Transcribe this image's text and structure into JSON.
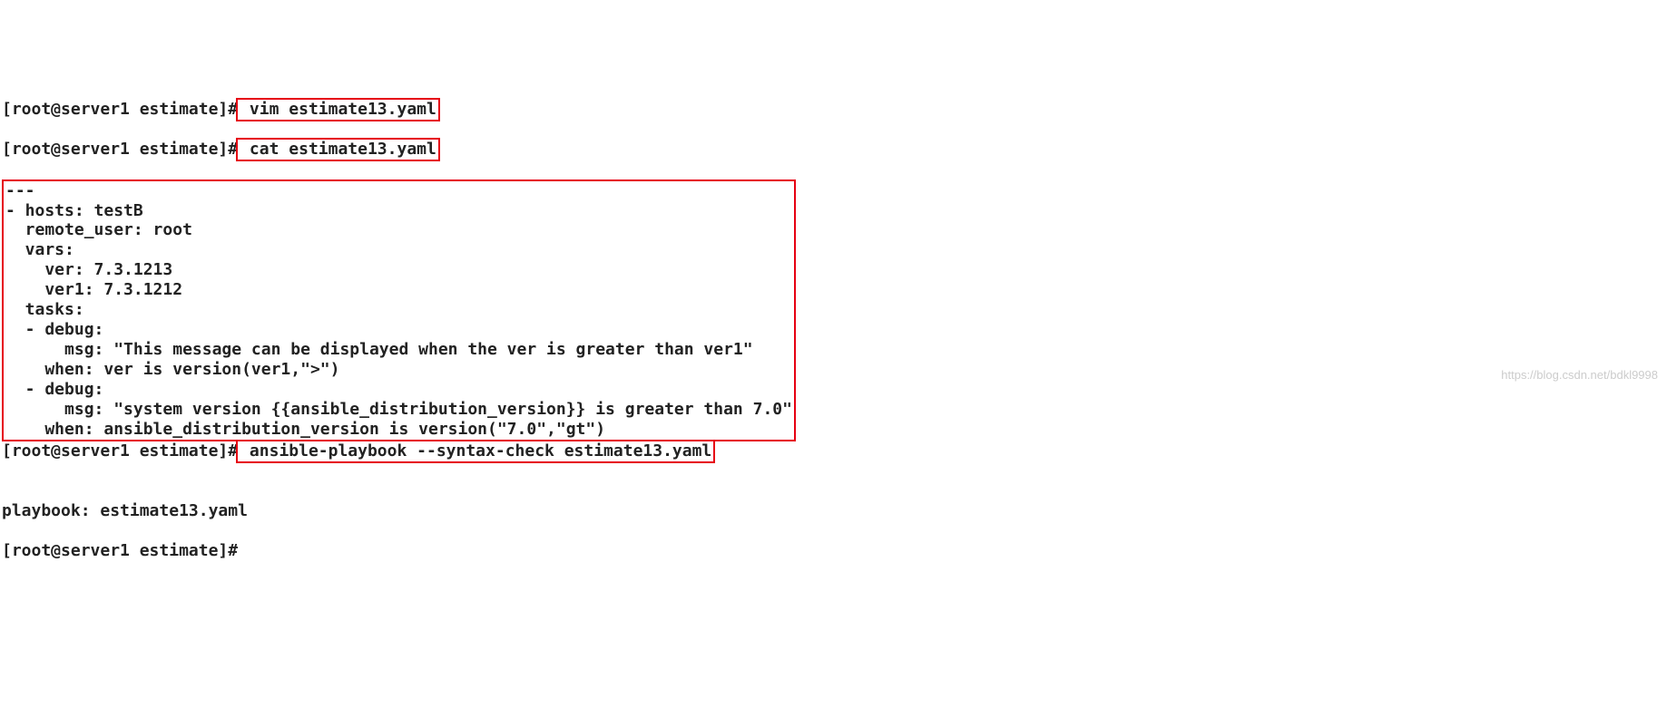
{
  "prompt": "[root@server1 estimate]#",
  "cmd1": " vim estimate13.yaml",
  "cmd2": " cat estimate13.yaml",
  "yaml": "---\n- hosts: testB\n  remote_user: root\n  vars:\n    ver: 7.3.1213\n    ver1: 7.3.1212\n  tasks:\n  - debug:\n      msg: \"This message can be displayed when the ver is greater than ver1\"\n    when: ver is version(ver1,\">\")\n  - debug:\n      msg: \"system version {{ansible_distribution_version}} is greater than 7.0\"\n    when: ansible_distribution_version is version(\"7.0\",\"gt\")",
  "cmd3": " ansible-playbook --syntax-check estimate13.yaml",
  "blank": "",
  "out1": "playbook: estimate13.yaml",
  "watermark": "https://blog.csdn.net/bdkl9998"
}
